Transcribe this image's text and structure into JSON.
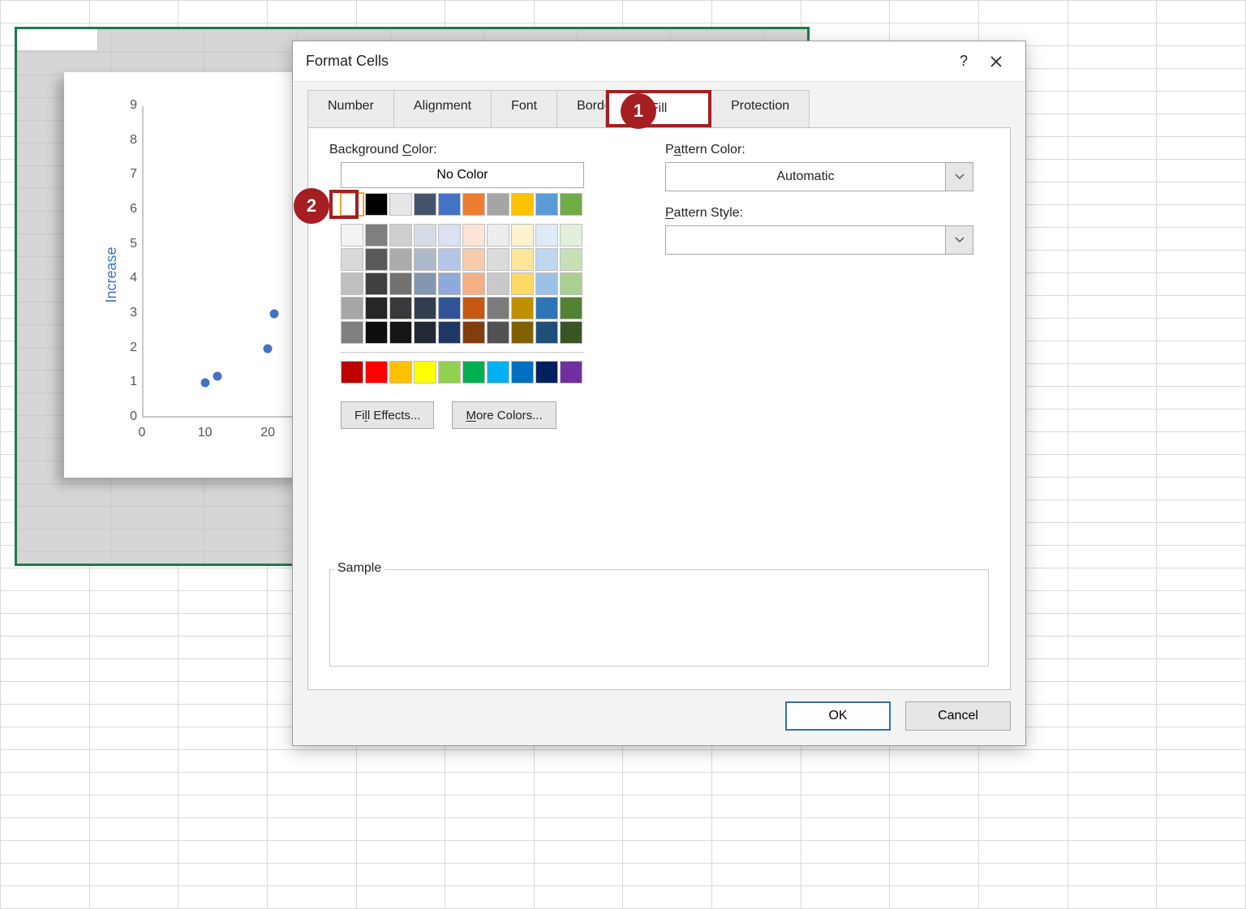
{
  "dialog": {
    "title": "Format Cells",
    "help": "?",
    "tabs": [
      "Number",
      "Alignment",
      "Font",
      "Border",
      "Fill",
      "Protection"
    ],
    "active_tab": "Fill",
    "fill": {
      "bg_label": "Background Color:",
      "bg_label_underline_letter": "C",
      "no_color": "No Color",
      "fill_effects": "Fill Effects...",
      "fill_effects_underline_letter": "I",
      "more_colors": "More Colors...",
      "more_colors_underline_letter": "M",
      "pattern_color_label": "Pattern Color:",
      "pattern_color_underline_letter": "A",
      "pattern_color_value": "Automatic",
      "pattern_style_label": "Pattern Style:",
      "pattern_style_underline_letter": "P",
      "sample_label": "Sample"
    },
    "buttons": {
      "ok": "OK",
      "cancel": "Cancel"
    }
  },
  "callouts": {
    "one": "1",
    "two": "2"
  },
  "colors": {
    "row1": [
      "#ffffff",
      "#000000",
      "#e7e6e6",
      "#44546a",
      "#4472c4",
      "#ed7d31",
      "#a5a5a5",
      "#ffc000",
      "#5b9bd5",
      "#70ad47"
    ],
    "shades": [
      [
        "#f2f2f2",
        "#7f7f7f",
        "#d0cece",
        "#d6dce5",
        "#d9e1f2",
        "#fce4d6",
        "#ededed",
        "#fff2cc",
        "#ddebf7",
        "#e2efda"
      ],
      [
        "#d9d9d9",
        "#595959",
        "#aeaaaa",
        "#acb9ca",
        "#b4c6e7",
        "#f8cbad",
        "#dbdbdb",
        "#ffe699",
        "#bdd7ee",
        "#c6e0b4"
      ],
      [
        "#bfbfbf",
        "#404040",
        "#757171",
        "#8497b0",
        "#8ea9db",
        "#f4b084",
        "#c9c9c9",
        "#ffd966",
        "#9bc2e6",
        "#a9d08e"
      ],
      [
        "#a6a6a6",
        "#262626",
        "#3a3838",
        "#333f4f",
        "#305496",
        "#c65911",
        "#7b7b7b",
        "#bf8f00",
        "#2f75b5",
        "#548235"
      ],
      [
        "#808080",
        "#0d0d0d",
        "#161616",
        "#222b35",
        "#203764",
        "#833c0c",
        "#525252",
        "#806000",
        "#1f4e78",
        "#375623"
      ]
    ],
    "standard": [
      "#c00000",
      "#ff0000",
      "#ffc000",
      "#ffff00",
      "#92d050",
      "#00b050",
      "#00b0f0",
      "#0070c0",
      "#002060",
      "#7030a0"
    ]
  },
  "chart_data": {
    "type": "scatter",
    "ylabel": "Increase",
    "x_ticks": [
      0,
      10,
      20
    ],
    "y_ticks": [
      0,
      1,
      2,
      3,
      4,
      5,
      6,
      7,
      8,
      9
    ],
    "xlim": [
      0,
      25
    ],
    "ylim": [
      0,
      9
    ],
    "points": [
      {
        "x": 10,
        "y": 1
      },
      {
        "x": 12,
        "y": 1.2
      },
      {
        "x": 20,
        "y": 2
      },
      {
        "x": 21,
        "y": 3
      }
    ]
  }
}
